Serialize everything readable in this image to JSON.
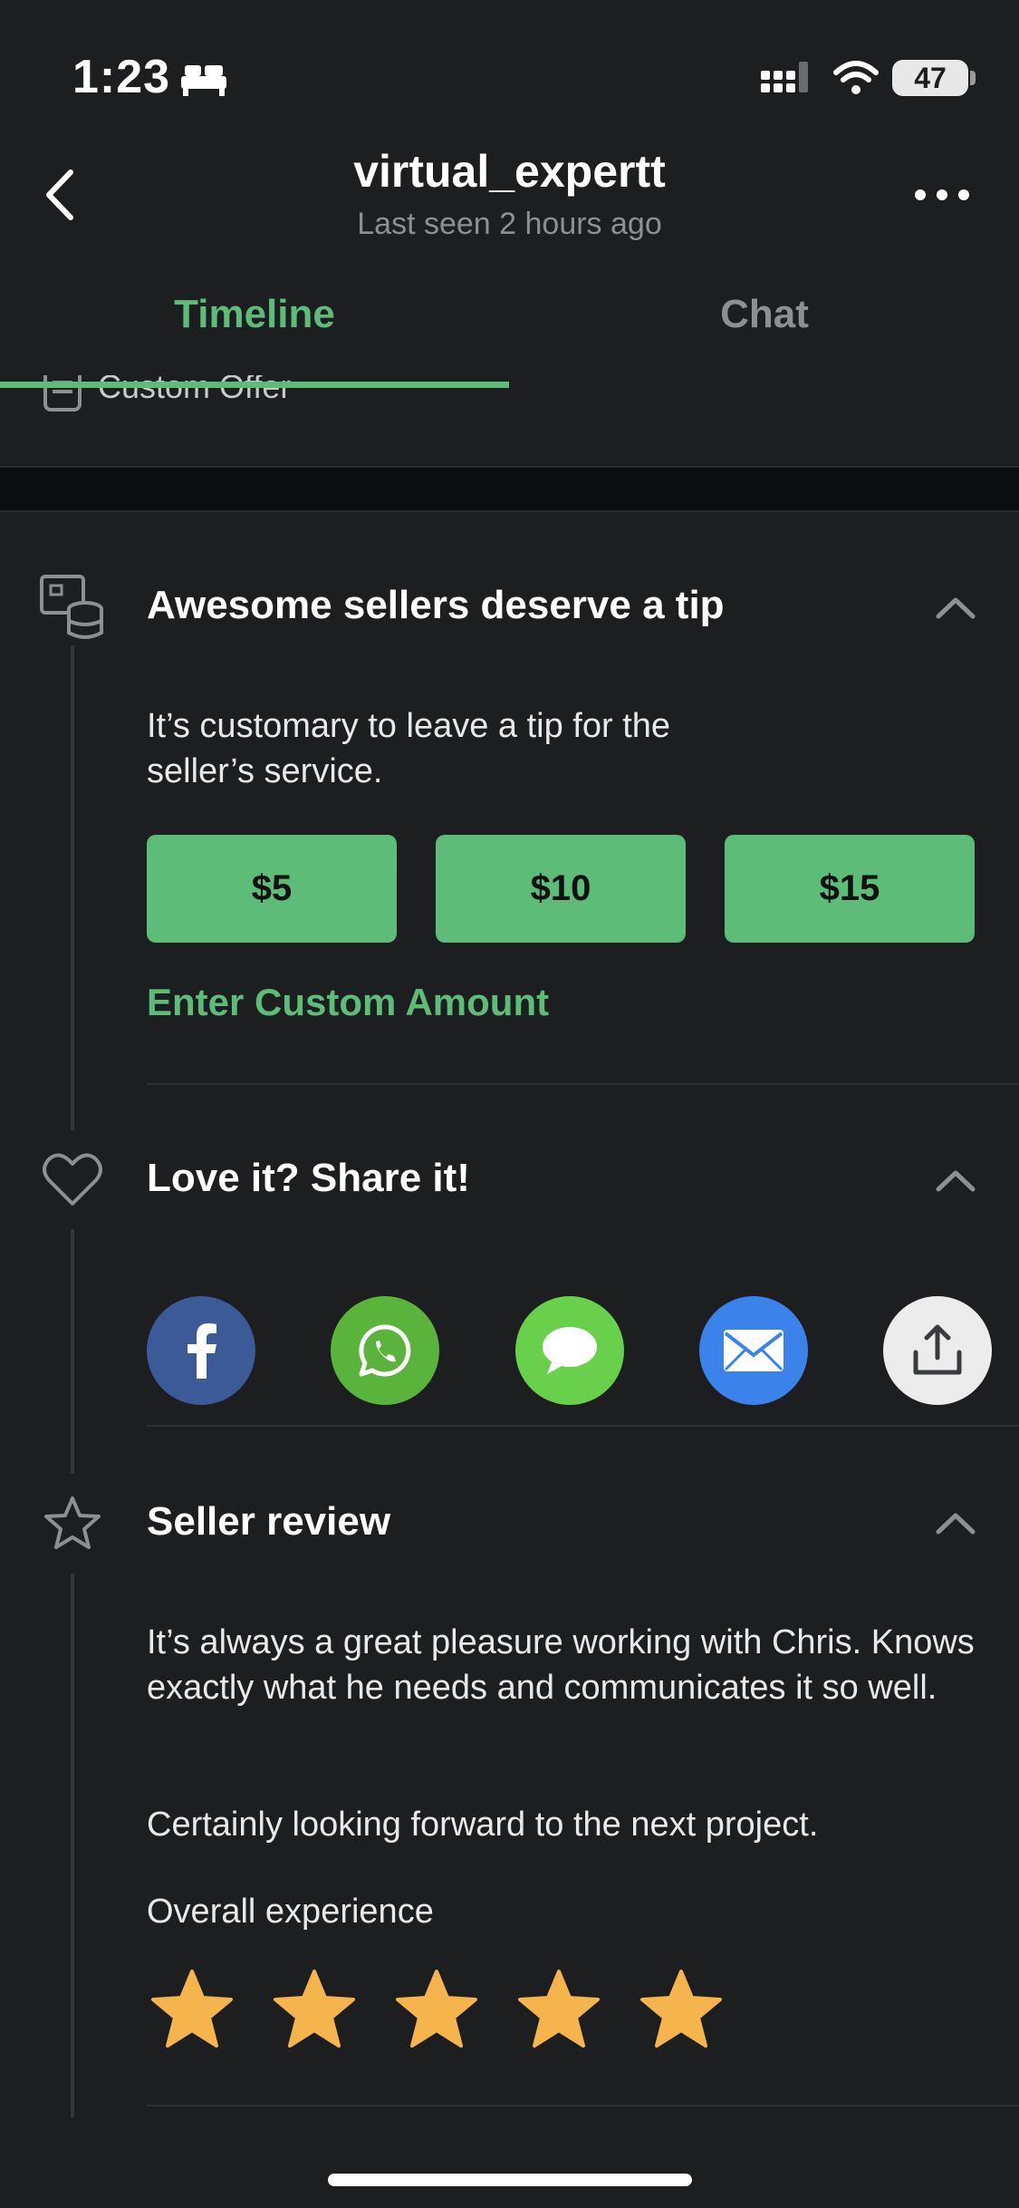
{
  "status_bar": {
    "time": "1:23",
    "battery": "47"
  },
  "header": {
    "title": "virtual_expertt",
    "subtitle": "Last seen 2 hours ago"
  },
  "tabs": [
    {
      "label": "Timeline",
      "active": true
    },
    {
      "label": "Chat",
      "active": false
    }
  ],
  "previous_item": {
    "label": "Custom Offer"
  },
  "tip_section": {
    "title": "Awesome sellers deserve a tip",
    "description": "It’s customary to leave a tip for the seller’s service.",
    "amounts": [
      "$5",
      "$10",
      "$15"
    ],
    "custom_label": "Enter Custom Amount"
  },
  "share_section": {
    "title": "Love it? Share it!",
    "options": [
      "facebook-icon",
      "whatsapp-icon",
      "messages-icon",
      "mail-icon",
      "share-upload-icon"
    ]
  },
  "review_section": {
    "title": "Seller review",
    "text_1": "It’s always a great pleasure working with Chris. Knows exactly what he needs and communicates it so well.",
    "text_2": "Certainly looking forward to the next project.",
    "rating_label": "Overall experience",
    "rating": 5
  },
  "colors": {
    "accent": "#5cbc78",
    "background": "#1d1e20",
    "facebook": "#3d5a98",
    "whatsapp": "#5ab43c",
    "messages": "#68d04a",
    "mail": "#3b82ea",
    "star": "#f6b44d"
  }
}
